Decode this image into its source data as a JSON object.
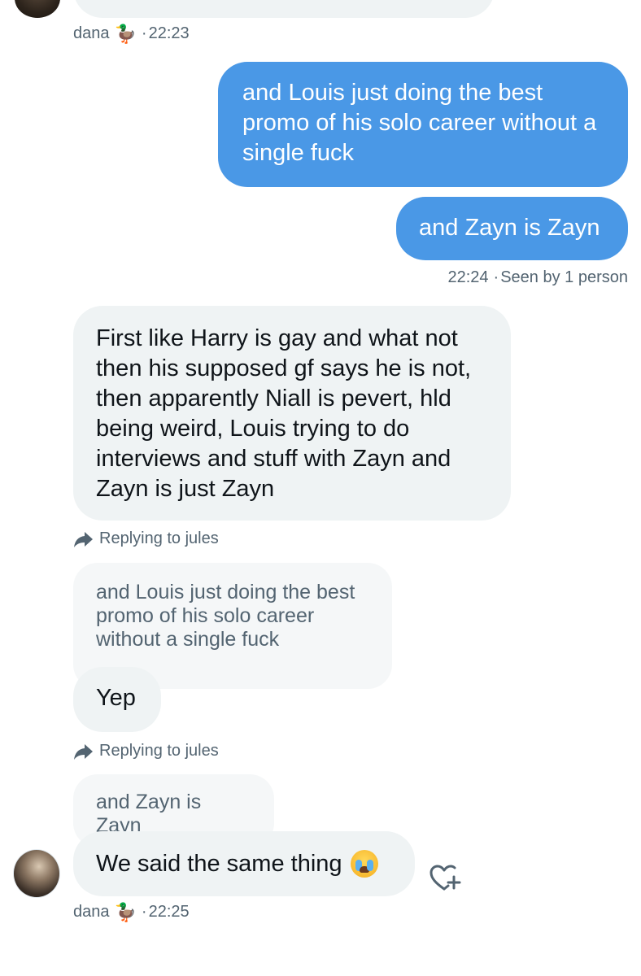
{
  "top_meta": {
    "name": "dana",
    "emoji": "🦆",
    "time": "22:23"
  },
  "sent_messages": [
    "and Louis just doing the best promo of his solo career without a single fuck",
    "and Zayn is Zayn"
  ],
  "sent_status": {
    "time": "22:24",
    "seen": "Seen by 1 person"
  },
  "received_long": "First like Harry is gay and what not then his supposed gf says he is not, then apparently Niall is pevert, hld being weird, Louis trying to do interviews and stuff with Zayn and Zayn is just Zayn",
  "reply_1": {
    "label": "Replying to jules",
    "quote": "and Louis just doing the best promo of his solo career without a single fuck",
    "message": "Yep"
  },
  "reply_2": {
    "label": "Replying to jules",
    "quote": "and Zayn is Zayn",
    "message": "We said the same thing",
    "emoji_name": "loudly-crying-face"
  },
  "bottom_meta": {
    "name": "dana",
    "emoji": "🦆",
    "time": "22:25"
  },
  "colors": {
    "sent": "#4a98e6",
    "received": "#eff3f4",
    "meta": "#536471"
  }
}
